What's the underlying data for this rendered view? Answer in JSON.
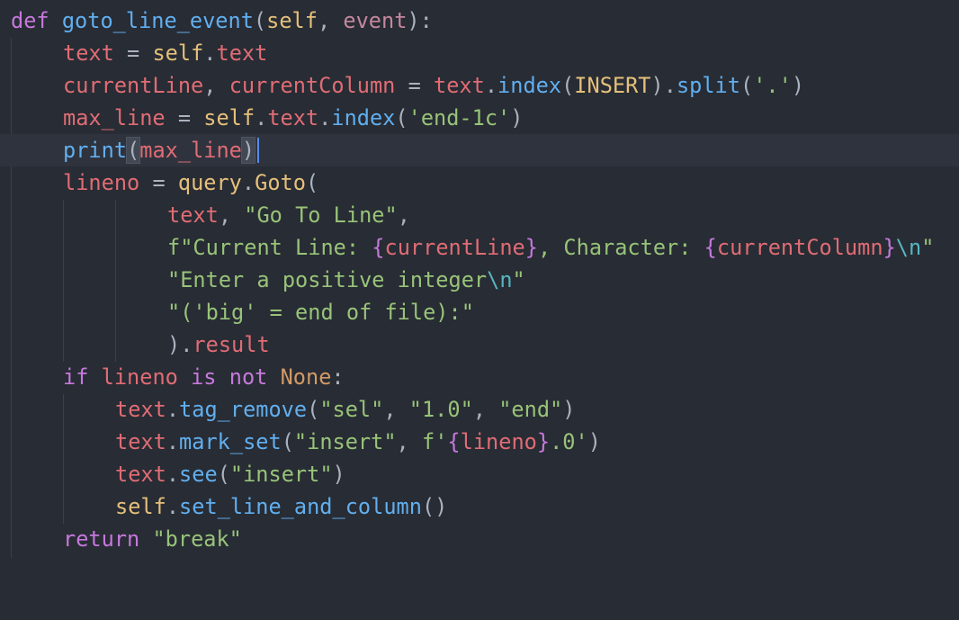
{
  "editor": {
    "language": "python",
    "theme": "one-dark",
    "current_line": 5,
    "colors": {
      "background": "#282c34",
      "current_line": "#2f333d",
      "cursor": "#528bff",
      "keyword": "#c678dd",
      "function": "#61afef",
      "variable": "#e06c75",
      "self": "#e5c07b",
      "string": "#98c379",
      "escape": "#56b6c2",
      "constant": "#d19a66",
      "punctuation": "#abb2bf"
    },
    "lines": [
      "def goto_line_event(self, event):",
      "    text = self.text",
      "    currentLine, currentColumn = text.index(INSERT).split('.')",
      "    max_line = self.text.index('end-1c')",
      "    print(max_line)",
      "    lineno = query.Goto(",
      "            text, \"Go To Line\",",
      "            f\"Current Line: {currentLine}, Character: {currentColumn}\\n\"",
      "            \"Enter a positive integer\\n\"",
      "            \"('big' = end of file):\"",
      "            ).result",
      "    if lineno is not None:",
      "        text.tag_remove(\"sel\", \"1.0\", \"end\")",
      "        text.mark_set(\"insert\", f'{lineno}.0')",
      "        text.see(\"insert\")",
      "        self.set_line_and_column()",
      "    return \"break\""
    ],
    "tokens": {
      "l1": [
        "def",
        " ",
        "goto_line_event",
        "(",
        "self",
        ", ",
        "event",
        "):"
      ],
      "l2": [
        "text",
        " = ",
        "self",
        ".",
        "text"
      ],
      "l3": [
        "currentLine",
        ", ",
        "currentColumn",
        " = ",
        "text",
        ".",
        "index",
        "(",
        "INSERT",
        ").",
        "split",
        "(",
        "'.'",
        ")"
      ],
      "l4": [
        "max_line",
        " = ",
        "self",
        ".",
        "text",
        ".",
        "index",
        "(",
        "'end-1c'",
        ")"
      ],
      "l5": [
        "print",
        "(",
        "max_line",
        ")"
      ],
      "l6": [
        "lineno",
        " = ",
        "query",
        ".",
        "Goto",
        "("
      ],
      "l7": [
        "text",
        ", ",
        "\"Go To Line\"",
        ","
      ],
      "l8": [
        "f",
        "\"Current Line: ",
        "{",
        "currentLine",
        "}",
        ", Character: ",
        "{",
        "currentColumn",
        "}",
        "\\n",
        "\""
      ],
      "l9": [
        "\"Enter a positive integer",
        "\\n",
        "\""
      ],
      "l10": [
        "\"('big' = end of file):\""
      ],
      "l11": [
        ").",
        "result"
      ],
      "l12": [
        "if",
        " ",
        "lineno",
        " ",
        "is",
        " ",
        "not",
        " ",
        "None",
        ":"
      ],
      "l13": [
        "text",
        ".",
        "tag_remove",
        "(",
        "\"sel\"",
        ", ",
        "\"1.0\"",
        ", ",
        "\"end\"",
        ")"
      ],
      "l14": [
        "text",
        ".",
        "mark_set",
        "(",
        "\"insert\"",
        ", ",
        "f",
        "'",
        "{",
        "lineno",
        "}",
        ".0'",
        ")"
      ],
      "l15": [
        "text",
        ".",
        "see",
        "(",
        "\"insert\"",
        ")"
      ],
      "l16": [
        "self",
        ".",
        "set_line_and_column",
        "()"
      ],
      "l17": [
        "return",
        " ",
        "\"break\""
      ]
    }
  }
}
